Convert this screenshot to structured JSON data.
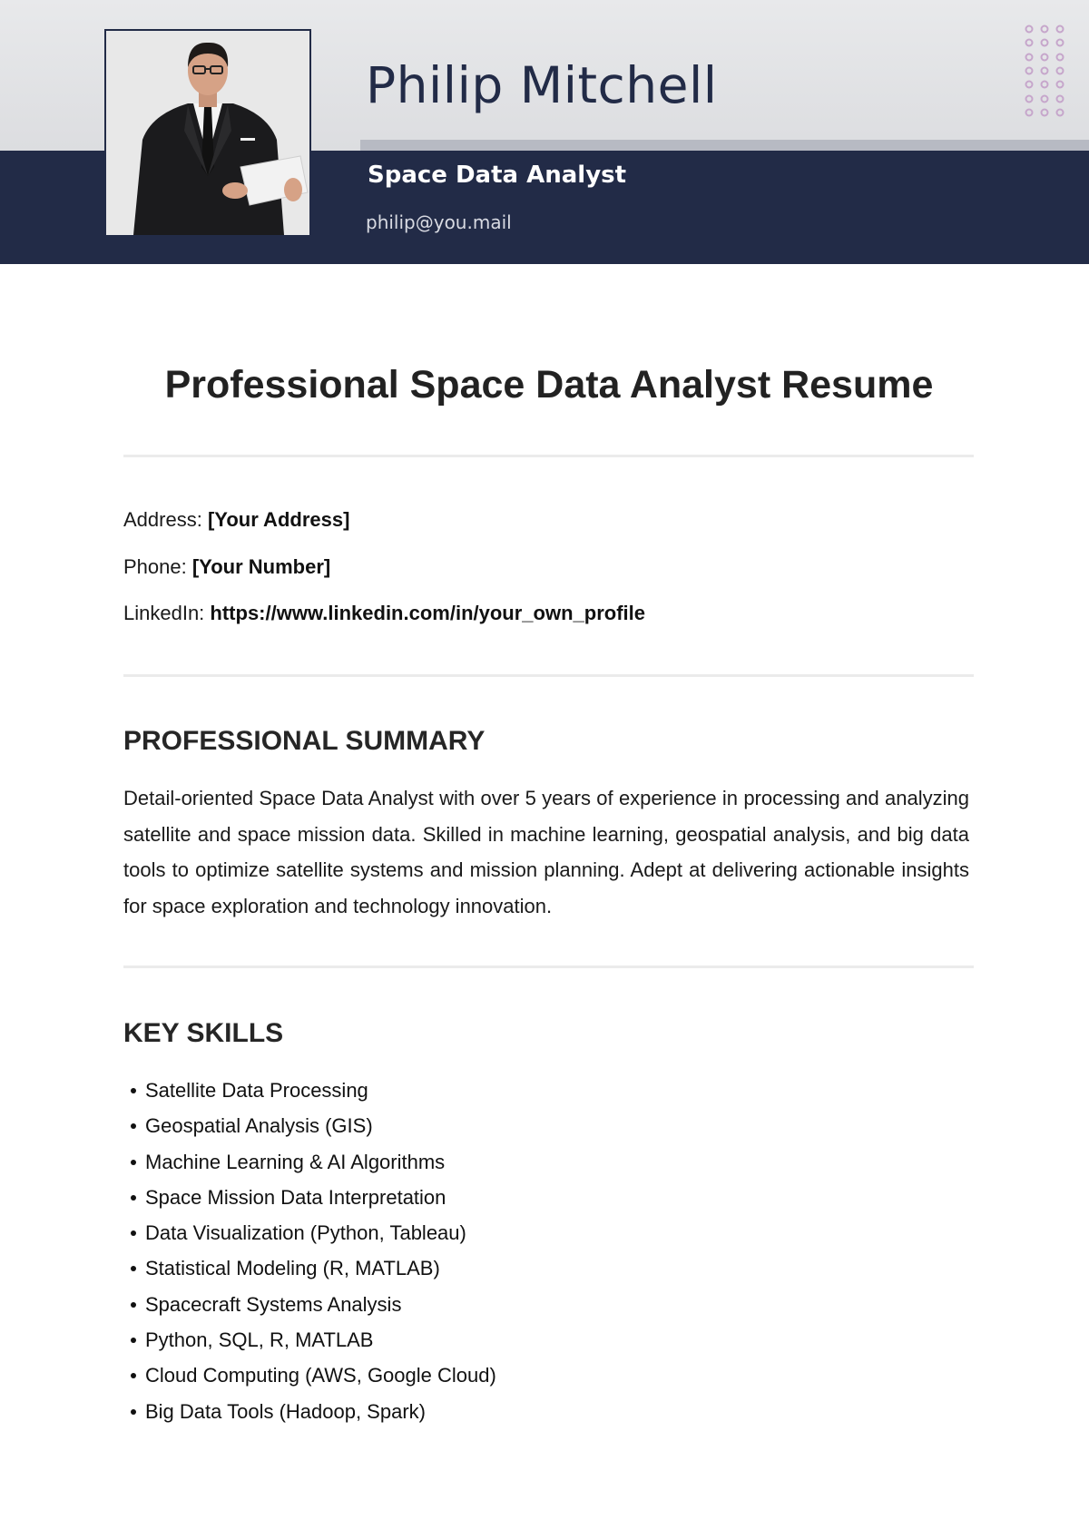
{
  "header": {
    "name": "Philip Mitchell",
    "job_title": "Space Data Analyst",
    "email": "philip@you.mail",
    "photo_icon": "profile-photo",
    "decoration_icon": "dot-grid-icon",
    "colors": {
      "navy": "#222b47",
      "header_grey": "#e3e4e7",
      "stripe_grey": "#b7bac3",
      "dot_purple": "#c6a6cb"
    }
  },
  "document": {
    "title": "Professional Space Data Analyst Resume"
  },
  "contact": {
    "address_label": "Address:",
    "address_value": "[Your Address]",
    "phone_label": "Phone:",
    "phone_value": "[Your Number]",
    "linkedin_label": "LinkedIn:",
    "linkedin_value": "https://www.linkedin.com/in/your_own_profile"
  },
  "summary": {
    "heading": "PROFESSIONAL SUMMARY",
    "text": "Detail-oriented Space Data Analyst with over 5 years of experience in processing and analyzing satellite and space mission data. Skilled in machine learning, geospatial analysis, and big data tools to optimize satellite systems and mission planning. Adept at delivering actionable insights for space exploration and technology innovation."
  },
  "skills": {
    "heading": "KEY SKILLS",
    "items": [
      "Satellite Data Processing",
      "Geospatial Analysis (GIS)",
      "Machine Learning & AI Algorithms",
      "Space Mission Data Interpretation",
      "Data Visualization (Python, Tableau)",
      "Statistical Modeling (R, MATLAB)",
      "Spacecraft Systems Analysis",
      "Python, SQL, R, MATLAB",
      "Cloud Computing (AWS, Google Cloud)",
      "Big Data Tools (Hadoop, Spark)"
    ]
  }
}
